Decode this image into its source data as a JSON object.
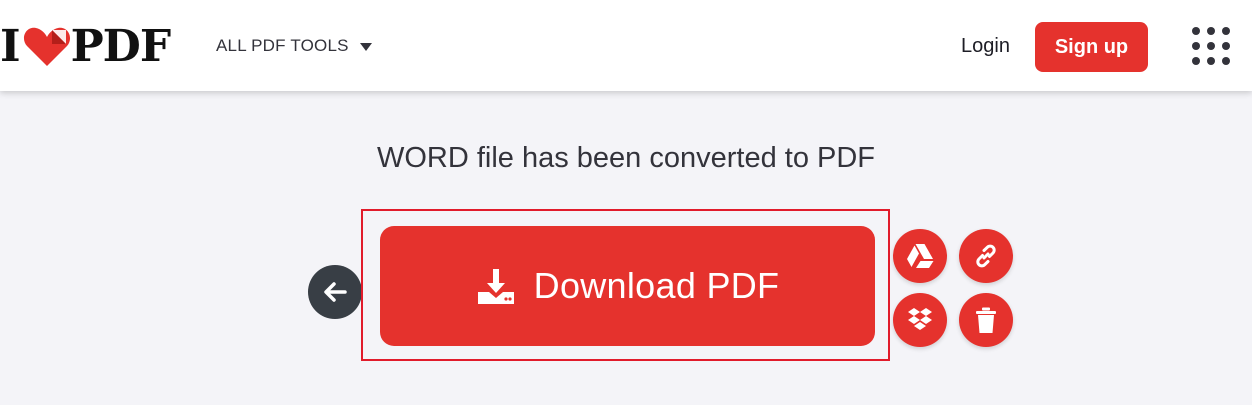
{
  "header": {
    "logo": {
      "letter_i": "I",
      "letters_pdf": "PDF"
    },
    "nav_tools_label": "ALL PDF TOOLS",
    "login_label": "Login",
    "signup_label": "Sign up"
  },
  "main": {
    "title": "WORD file has been converted to PDF",
    "download_label": "Download PDF"
  },
  "icons": {
    "heart": "heart-logo-icon",
    "caret": "caret-down-icon",
    "apps": "grid-apps-icon",
    "back": "arrow-left-icon",
    "download": "download-icon",
    "gdrive": "google-drive-icon",
    "link": "link-icon",
    "dropbox": "dropbox-icon",
    "trash": "trash-icon"
  },
  "colors": {
    "brand_red": "#e5322d",
    "dark_button": "#383e45",
    "focus_border": "#e11b2b",
    "page_bg": "#f4f4f8",
    "text": "#33333b"
  }
}
